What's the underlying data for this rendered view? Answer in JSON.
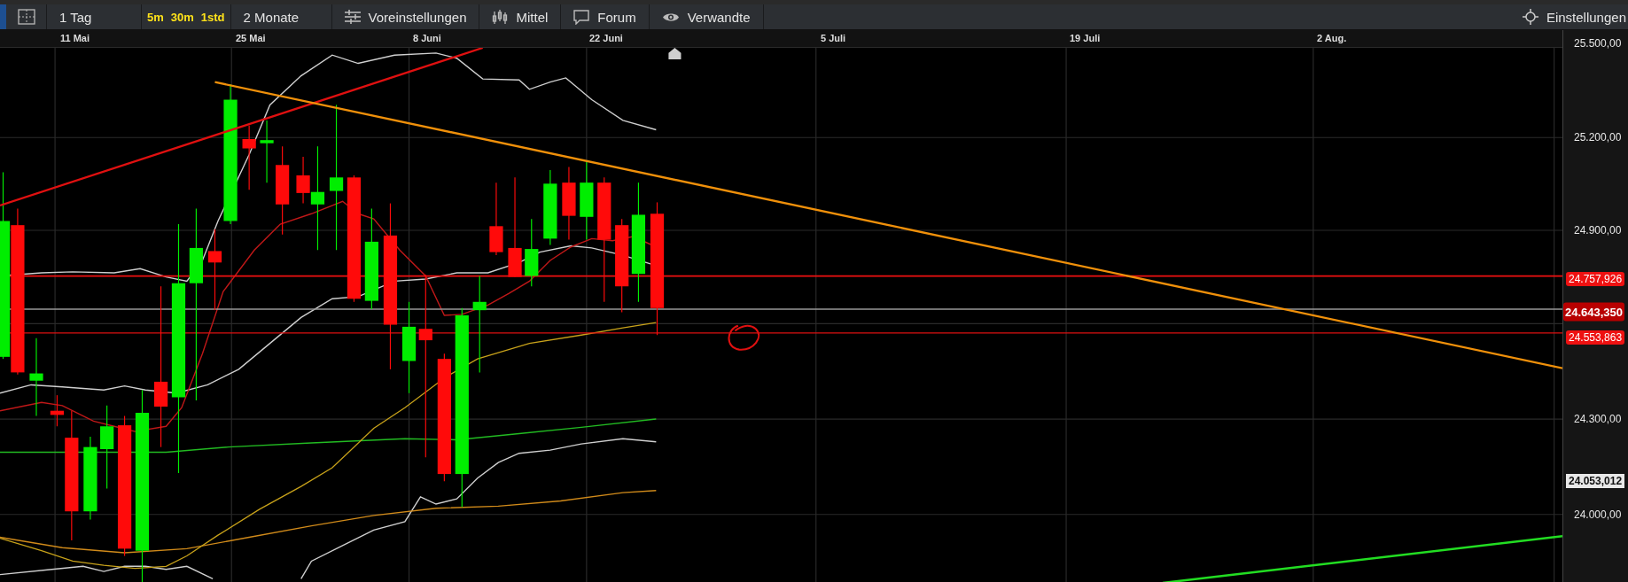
{
  "toolbar": {
    "period": "1 Tag",
    "intervals": [
      "5m",
      "30m",
      "1std"
    ],
    "range": "2 Monate",
    "buttons": [
      {
        "label": "Voreinstellungen",
        "kind": "sliders"
      },
      {
        "label": "Mittel",
        "kind": "candles"
      },
      {
        "label": "Forum",
        "kind": "chat"
      },
      {
        "label": "Verwandte",
        "kind": "eye"
      }
    ],
    "settings": {
      "label": "Einstellungen",
      "kind": "gear"
    }
  },
  "date_axis": [
    "11 Mai",
    "25 Mai",
    "8 Juni",
    "22 Juni",
    "5 Juli",
    "19 Juli",
    "2 Aug."
  ],
  "price_axis": {
    "ticks": [
      "25.500,00",
      "25.200,00",
      "24.900,00",
      "24.300,00",
      "24.000,00"
    ],
    "labels": [
      {
        "text": "24.757,926",
        "kind": "line"
      },
      {
        "text": "24.643,350",
        "kind": "current"
      },
      {
        "text": "24.553,863",
        "kind": "line"
      },
      {
        "text": "24.053,012",
        "kind": "marker"
      }
    ]
  }
}
